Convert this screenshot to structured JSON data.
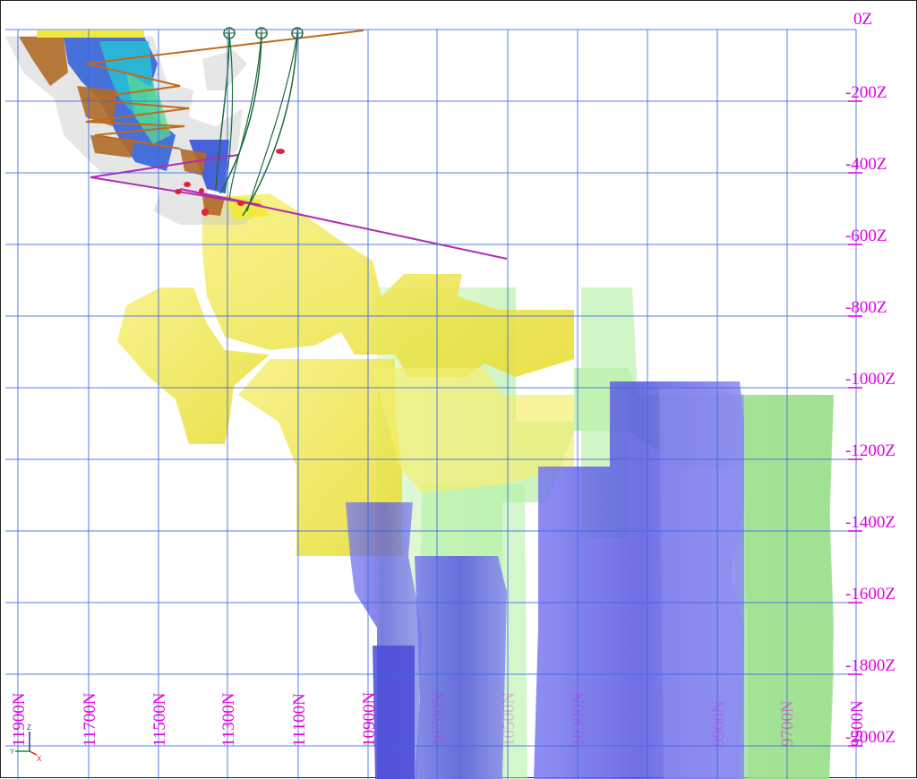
{
  "elevation_labels": [
    "0Z",
    "-200Z",
    "-400Z",
    "-600Z",
    "-800Z",
    "-1000Z",
    "-1200Z",
    "-1400Z",
    "-1600Z",
    "-1800Z",
    "-2000Z"
  ],
  "northing_labels": [
    "11900N",
    "11700N",
    "11500N",
    "11300N",
    "11100N",
    "10900N",
    "10700N",
    "10500N",
    "10300N",
    "9900N",
    "9700N",
    "9500N"
  ],
  "axis_triad": {
    "z": "Z",
    "y": "Y",
    "x": "X"
  },
  "colors": {
    "grid": "#3a66e8",
    "labels": "#e000e0",
    "yellow_body": "#f2ea3a",
    "green_body": "#9ef09a",
    "blue_body": "#5f5fe6",
    "drill_trace": "#1e6b3a",
    "ramp": "#c06a1a",
    "section_line": "#b42bb4"
  }
}
